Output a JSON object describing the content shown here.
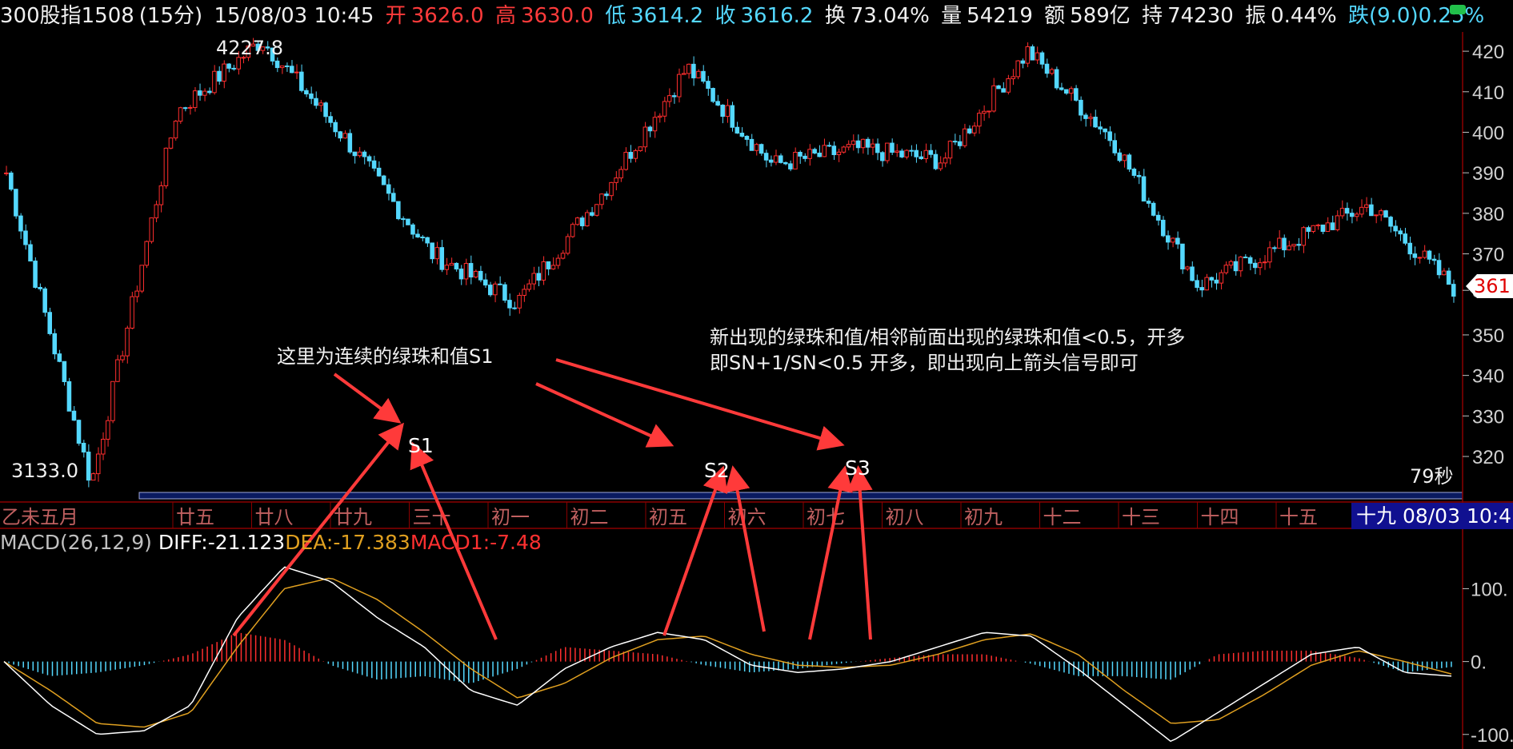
{
  "header": {
    "symbol": "300股指1508",
    "period": "(15分)",
    "datetime": "15/08/03 10:45",
    "open_label": "开",
    "open": "3626.0",
    "high_label": "高",
    "high": "3630.0",
    "low_label": "低",
    "low": "3614.2",
    "close_label": "收",
    "close": "3616.2",
    "turnover_label": "换",
    "turnover": "73.04%",
    "volume_label": "量",
    "volume": "54219",
    "amount_label": "额",
    "amount": "589亿",
    "oi_label": "持",
    "oi": "74230",
    "amplitude_label": "振",
    "amplitude": "0.44%",
    "change": "跌(9.0)0.25%"
  },
  "price_axis": [
    "420",
    "410",
    "400",
    "390",
    "380",
    "370",
    "361",
    "350",
    "340",
    "330",
    "320"
  ],
  "current_price_tag": "361",
  "max_label": "4227.8",
  "min_label": "3133.0",
  "seconds_label": "79秒",
  "date_axis": {
    "month_label": "乙未五月",
    "labels": [
      "廿五",
      "廿八",
      "廿九",
      "三十",
      "初一",
      "初二",
      "初五",
      "初六",
      "初七",
      "初八",
      "初九",
      "十二",
      "十三",
      "十四",
      "十五"
    ],
    "current": "十九 08/03 10:45"
  },
  "macd": {
    "name": "MACD(26,12,9)",
    "diff": "DIFF:-21.123",
    "dea": "DEA:-17.383",
    "macd": "MACD1:-7.48",
    "axis": [
      "100.",
      "0.",
      "-100."
    ]
  },
  "annotations": {
    "note_s1": "这里为连续的绿珠和值S1",
    "note_rule_line1": "新出现的绿珠和值/相邻前面出现的绿珠和值<0.5，开多",
    "note_rule_line2": "即SN+1/SN<0.5 开多，即出现向上箭头信号即可",
    "s1": "S1",
    "s2": "S2",
    "s3": "S3"
  },
  "colors": {
    "up": "#ff2e2e",
    "down": "#54d8ff",
    "diff": "#ffffff",
    "dea": "#e0a020",
    "arrow": "#ff3a3a",
    "grid": "#8a0000"
  },
  "chart_data": [
    {
      "type": "candlestick",
      "title": "300股指1508 (15分)",
      "ylim": [
        3133.0,
        4227.8
      ],
      "y_ticks": [
        4200,
        4100,
        4000,
        3900,
        3800,
        3700,
        3610,
        3500,
        3400,
        3300,
        3200
      ],
      "max": 4227.8,
      "min": 3133.0,
      "last": 3616.2,
      "trend_points": [
        {
          "x": "start",
          "close": 3900
        },
        {
          "x": "低点",
          "close": 3133
        },
        {
          "x": "廿五",
          "close": 4050
        },
        {
          "x": "廿八",
          "close": 4227.8
        },
        {
          "x": "廿九",
          "close": 3980
        },
        {
          "x": "三十",
          "close": 3700
        },
        {
          "x": "初一",
          "close": 3580
        },
        {
          "x": "初二",
          "close": 3850
        },
        {
          "x": "初五",
          "close": 4160
        },
        {
          "x": "初六",
          "close": 3920
        },
        {
          "x": "初七",
          "close": 3960
        },
        {
          "x": "初八",
          "close": 3930
        },
        {
          "x": "初九",
          "close": 4200
        },
        {
          "x": "十二",
          "close": 3980
        },
        {
          "x": "十三",
          "close": 3620
        },
        {
          "x": "十四",
          "close": 3720
        },
        {
          "x": "十五",
          "close": 3820
        },
        {
          "x": "十九",
          "close": 3616.2
        }
      ]
    },
    {
      "type": "bar",
      "title": "MACD(26,12,9)",
      "ylim": [
        -120,
        140
      ],
      "series": [
        {
          "name": "DIFF",
          "values": [
            0,
            -60,
            -100,
            -95,
            -60,
            60,
            130,
            110,
            60,
            20,
            -40,
            -60,
            -10,
            20,
            40,
            30,
            -5,
            -15,
            -10,
            0,
            20,
            40,
            35,
            -10,
            -60,
            -110,
            -70,
            -30,
            10,
            20,
            -15,
            -20
          ]
        },
        {
          "name": "DEA",
          "values": [
            0,
            -40,
            -85,
            -90,
            -70,
            20,
            100,
            115,
            85,
            40,
            -10,
            -50,
            -30,
            5,
            30,
            35,
            10,
            -5,
            -8,
            -5,
            10,
            30,
            38,
            10,
            -40,
            -85,
            -80,
            -45,
            -5,
            15,
            0,
            -17
          ]
        },
        {
          "name": "MACD1",
          "values": [
            0,
            -20,
            -15,
            -5,
            10,
            40,
            30,
            -5,
            -25,
            -20,
            -30,
            -10,
            20,
            15,
            10,
            -5,
            -15,
            -10,
            -2,
            5,
            10,
            10,
            -3,
            -20,
            -20,
            -25,
            10,
            15,
            15,
            5,
            -15,
            -7.48
          ]
        }
      ]
    }
  ]
}
